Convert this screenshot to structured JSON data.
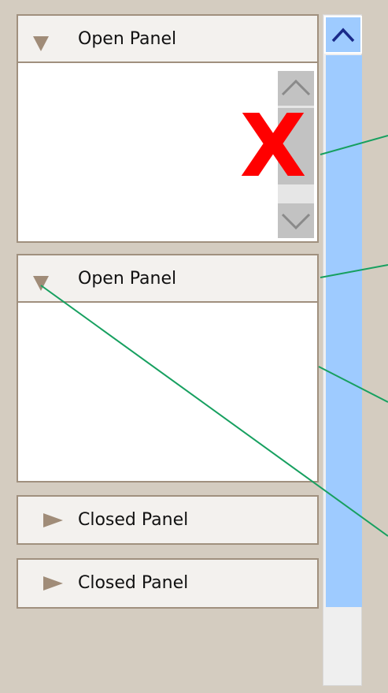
{
  "panels": [
    {
      "title": "Open Panel",
      "state": "open"
    },
    {
      "title": "Open Panel",
      "state": "open"
    },
    {
      "title": "Closed Panel",
      "state": "closed"
    },
    {
      "title": "Closed Panel",
      "state": "closed"
    }
  ],
  "marks": {
    "error_mark": "X"
  },
  "colors": {
    "background": "#d4ccc0",
    "panel_border": "#a0907e",
    "panel_header": "#f3f1ee",
    "triangle": "#a08c78",
    "scrollbar_thumb": "#9ecbff",
    "arrow_blue": "#1a2a8a",
    "error_red": "#ff0000",
    "leader_green": "#17a060"
  },
  "icons": {
    "panel_open": "triangle-down-icon",
    "panel_closed": "triangle-right-icon",
    "scroll_up": "chevron-up-icon",
    "scroll_down": "chevron-down-icon"
  }
}
